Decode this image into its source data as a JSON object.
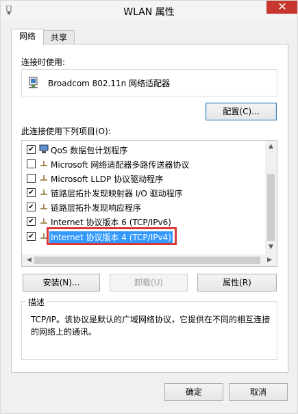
{
  "window": {
    "title": "WLAN 属性",
    "close_glyph": "✕"
  },
  "tabs": [
    {
      "label": "网络"
    },
    {
      "label": "共享"
    }
  ],
  "connect_using": {
    "label": "连接时使用:",
    "adapter_name": "Broadcom 802.11n 网络适配器"
  },
  "buttons": {
    "configure": "配置(C)...",
    "install": "安装(N)...",
    "uninstall": "卸载(U)",
    "properties": "属性(R)",
    "ok": "确定",
    "cancel": "取消"
  },
  "items_label": "此连接使用下列项目(O):",
  "items": [
    {
      "label": "QoS 数据包计划程序",
      "checked": true,
      "icon": "network-icon"
    },
    {
      "label": "Microsoft 网络适配器多路传送器协议",
      "checked": false,
      "icon": "protocol-icon"
    },
    {
      "label": "Microsoft LLDP 协议驱动程序",
      "checked": false,
      "icon": "protocol-icon"
    },
    {
      "label": "链路层拓扑发现映射器 I/O 驱动程序",
      "checked": true,
      "icon": "protocol-icon"
    },
    {
      "label": "链路层拓扑发现响应程序",
      "checked": true,
      "icon": "protocol-icon"
    },
    {
      "label": "Internet 协议版本 6 (TCP/IPv6)",
      "checked": true,
      "icon": "protocol-icon"
    },
    {
      "label": "Internet 协议版本 4 (TCP/IPv4)",
      "checked": true,
      "icon": "protocol-icon",
      "selected": true
    }
  ],
  "description": {
    "legend": "描述",
    "text": "TCP/IP。该协议是默认的广域网络协议，它提供在不同的相互连接的网络上的通讯。"
  },
  "colors": {
    "selection": "#3399ff",
    "highlight_border": "#d8383a",
    "close_button": "#c7372f"
  }
}
